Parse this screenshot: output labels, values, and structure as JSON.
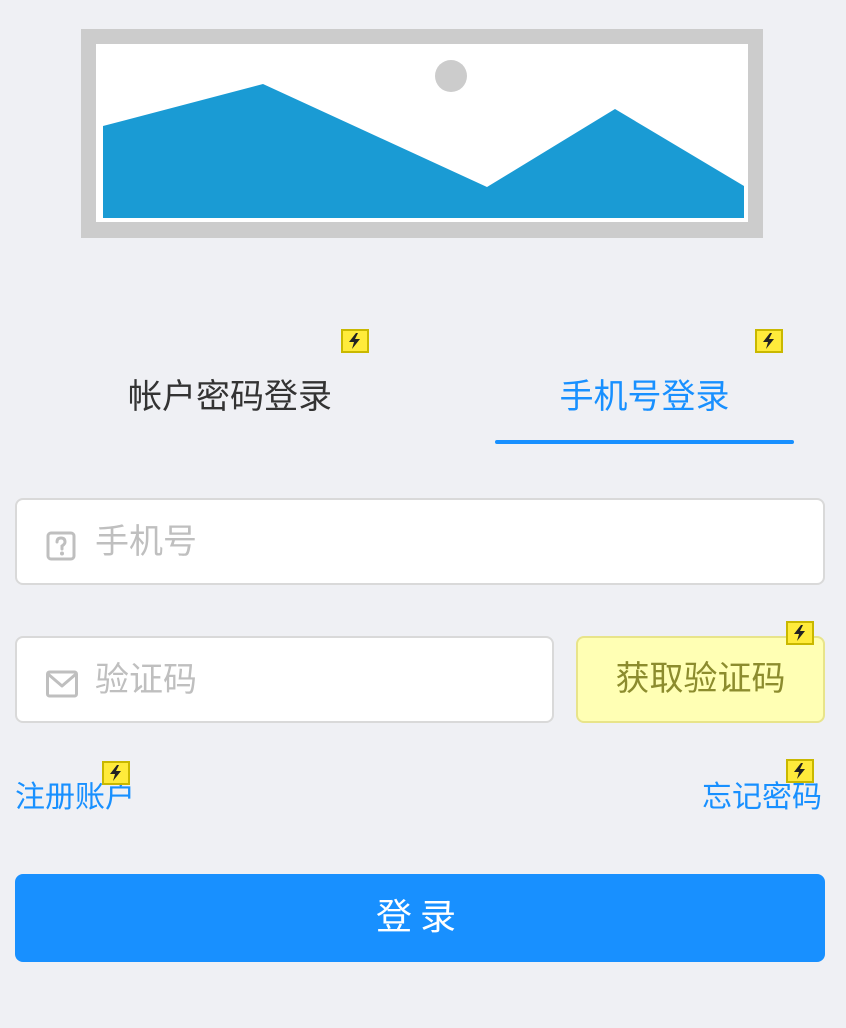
{
  "banner": {
    "icon": "image-placeholder-icon",
    "colors": {
      "frame": "#cccccc",
      "sky": "#ffffff",
      "mountains": "#1a9bd4",
      "sun": "#cccccc"
    }
  },
  "tabs": [
    {
      "label": "帐户密码登录",
      "active": false
    },
    {
      "label": "手机号登录",
      "active": true
    }
  ],
  "phone_field": {
    "icon": "question-mark-icon",
    "placeholder": "手机号",
    "value": ""
  },
  "code_field": {
    "icon": "mail-icon",
    "placeholder": "验证码",
    "value": ""
  },
  "get_code_label": "获取验证码",
  "register_label": "注册账户",
  "forgot_label": "忘记密码",
  "login_label": "登录",
  "markers": {
    "icon": "flash-icon",
    "color": "#ffeb3b"
  },
  "colors": {
    "primary": "#1890ff",
    "background": "#eff0f4"
  }
}
